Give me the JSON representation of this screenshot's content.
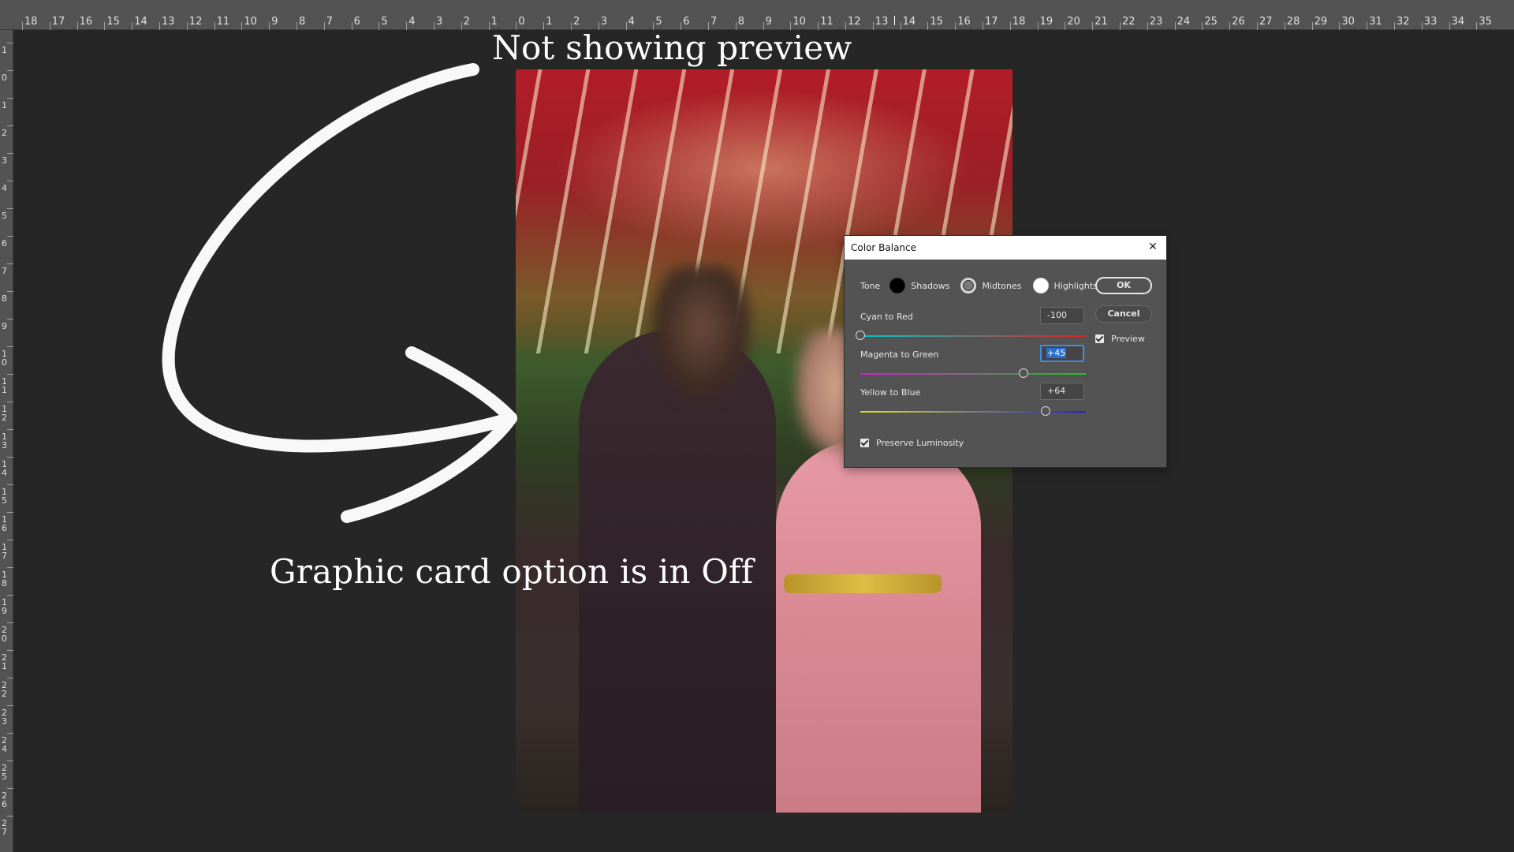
{
  "ruler": {
    "top_labels": [
      "18",
      "17",
      "16",
      "15",
      "14",
      "13",
      "12",
      "11",
      "10",
      "9",
      "8",
      "7",
      "6",
      "5",
      "4",
      "3",
      "2",
      "1",
      "0",
      "1",
      "2",
      "3",
      "4",
      "5",
      "6",
      "7",
      "8",
      "9",
      "10",
      "11",
      "12",
      "13",
      "14",
      "15",
      "16",
      "17",
      "18",
      "19",
      "20",
      "21",
      "22",
      "23",
      "24",
      "25",
      "26",
      "27",
      "28",
      "29",
      "30",
      "31",
      "32",
      "33",
      "34",
      "35"
    ],
    "left_labels": [
      "1",
      "0",
      "1",
      "2",
      "3",
      "4",
      "5",
      "6",
      "7",
      "8",
      "9",
      "10",
      "11",
      "12",
      "13",
      "14",
      "15",
      "16",
      "17",
      "18",
      "19",
      "20",
      "21",
      "22",
      "23",
      "24",
      "25",
      "26",
      "27"
    ]
  },
  "annotations": {
    "top_text": "Not showing preview",
    "bottom_text": "Graphic card option is in Off"
  },
  "dialog": {
    "title": "Color Balance",
    "tone_label": "Tone",
    "tones": [
      {
        "label": "Shadows",
        "selected": false
      },
      {
        "label": "Midtones",
        "selected": true
      },
      {
        "label": "Highlights",
        "selected": false
      }
    ],
    "sliders": [
      {
        "label": "Cyan to Red",
        "value": "-100",
        "level": -100,
        "min": -100,
        "max": 100,
        "left_color": "#00c8c8",
        "right_color": "#e02020"
      },
      {
        "label": "Magenta to Green",
        "value": "+45",
        "level": 45,
        "min": -100,
        "max": 100,
        "left_color": "#d020d0",
        "right_color": "#20c020"
      },
      {
        "label": "Yellow to Blue",
        "value": "+64",
        "level": 64,
        "min": -100,
        "max": 100,
        "left_color": "#e0e020",
        "right_color": "#2020e0"
      }
    ],
    "preserve_luminosity": {
      "label": "Preserve Luminosity",
      "checked": true
    },
    "ok_label": "OK",
    "cancel_label": "Cancel",
    "preview": {
      "label": "Preview",
      "checked": true
    }
  }
}
